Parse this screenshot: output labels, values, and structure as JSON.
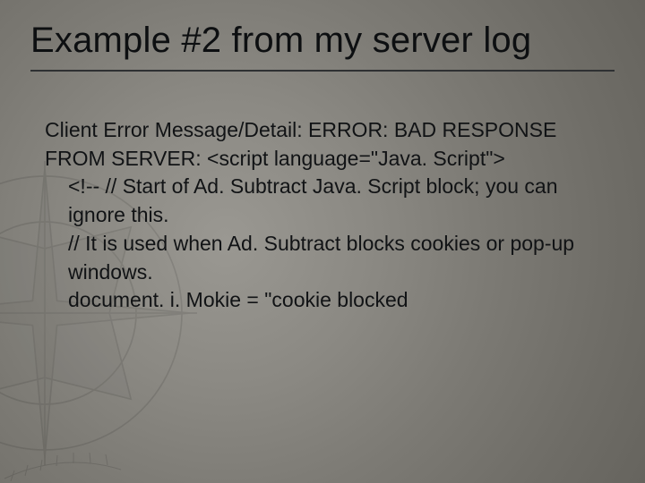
{
  "slide": {
    "title": "Example #2 from my server log",
    "lines": [
      {
        "text": "Client Error Message/Detail: ERROR: BAD RESPONSE FROM SERVER: <script language=\"Java. Script\">",
        "indent": false
      },
      {
        "text": "<!-- // Start of Ad. Subtract Java. Script block; you can ignore this.",
        "indent": true
      },
      {
        "text": "// It is used when Ad. Subtract blocks cookies or pop-up windows.",
        "indent": true
      },
      {
        "text": "document. i. Mokie = \"cookie blocked",
        "indent": true
      }
    ]
  }
}
